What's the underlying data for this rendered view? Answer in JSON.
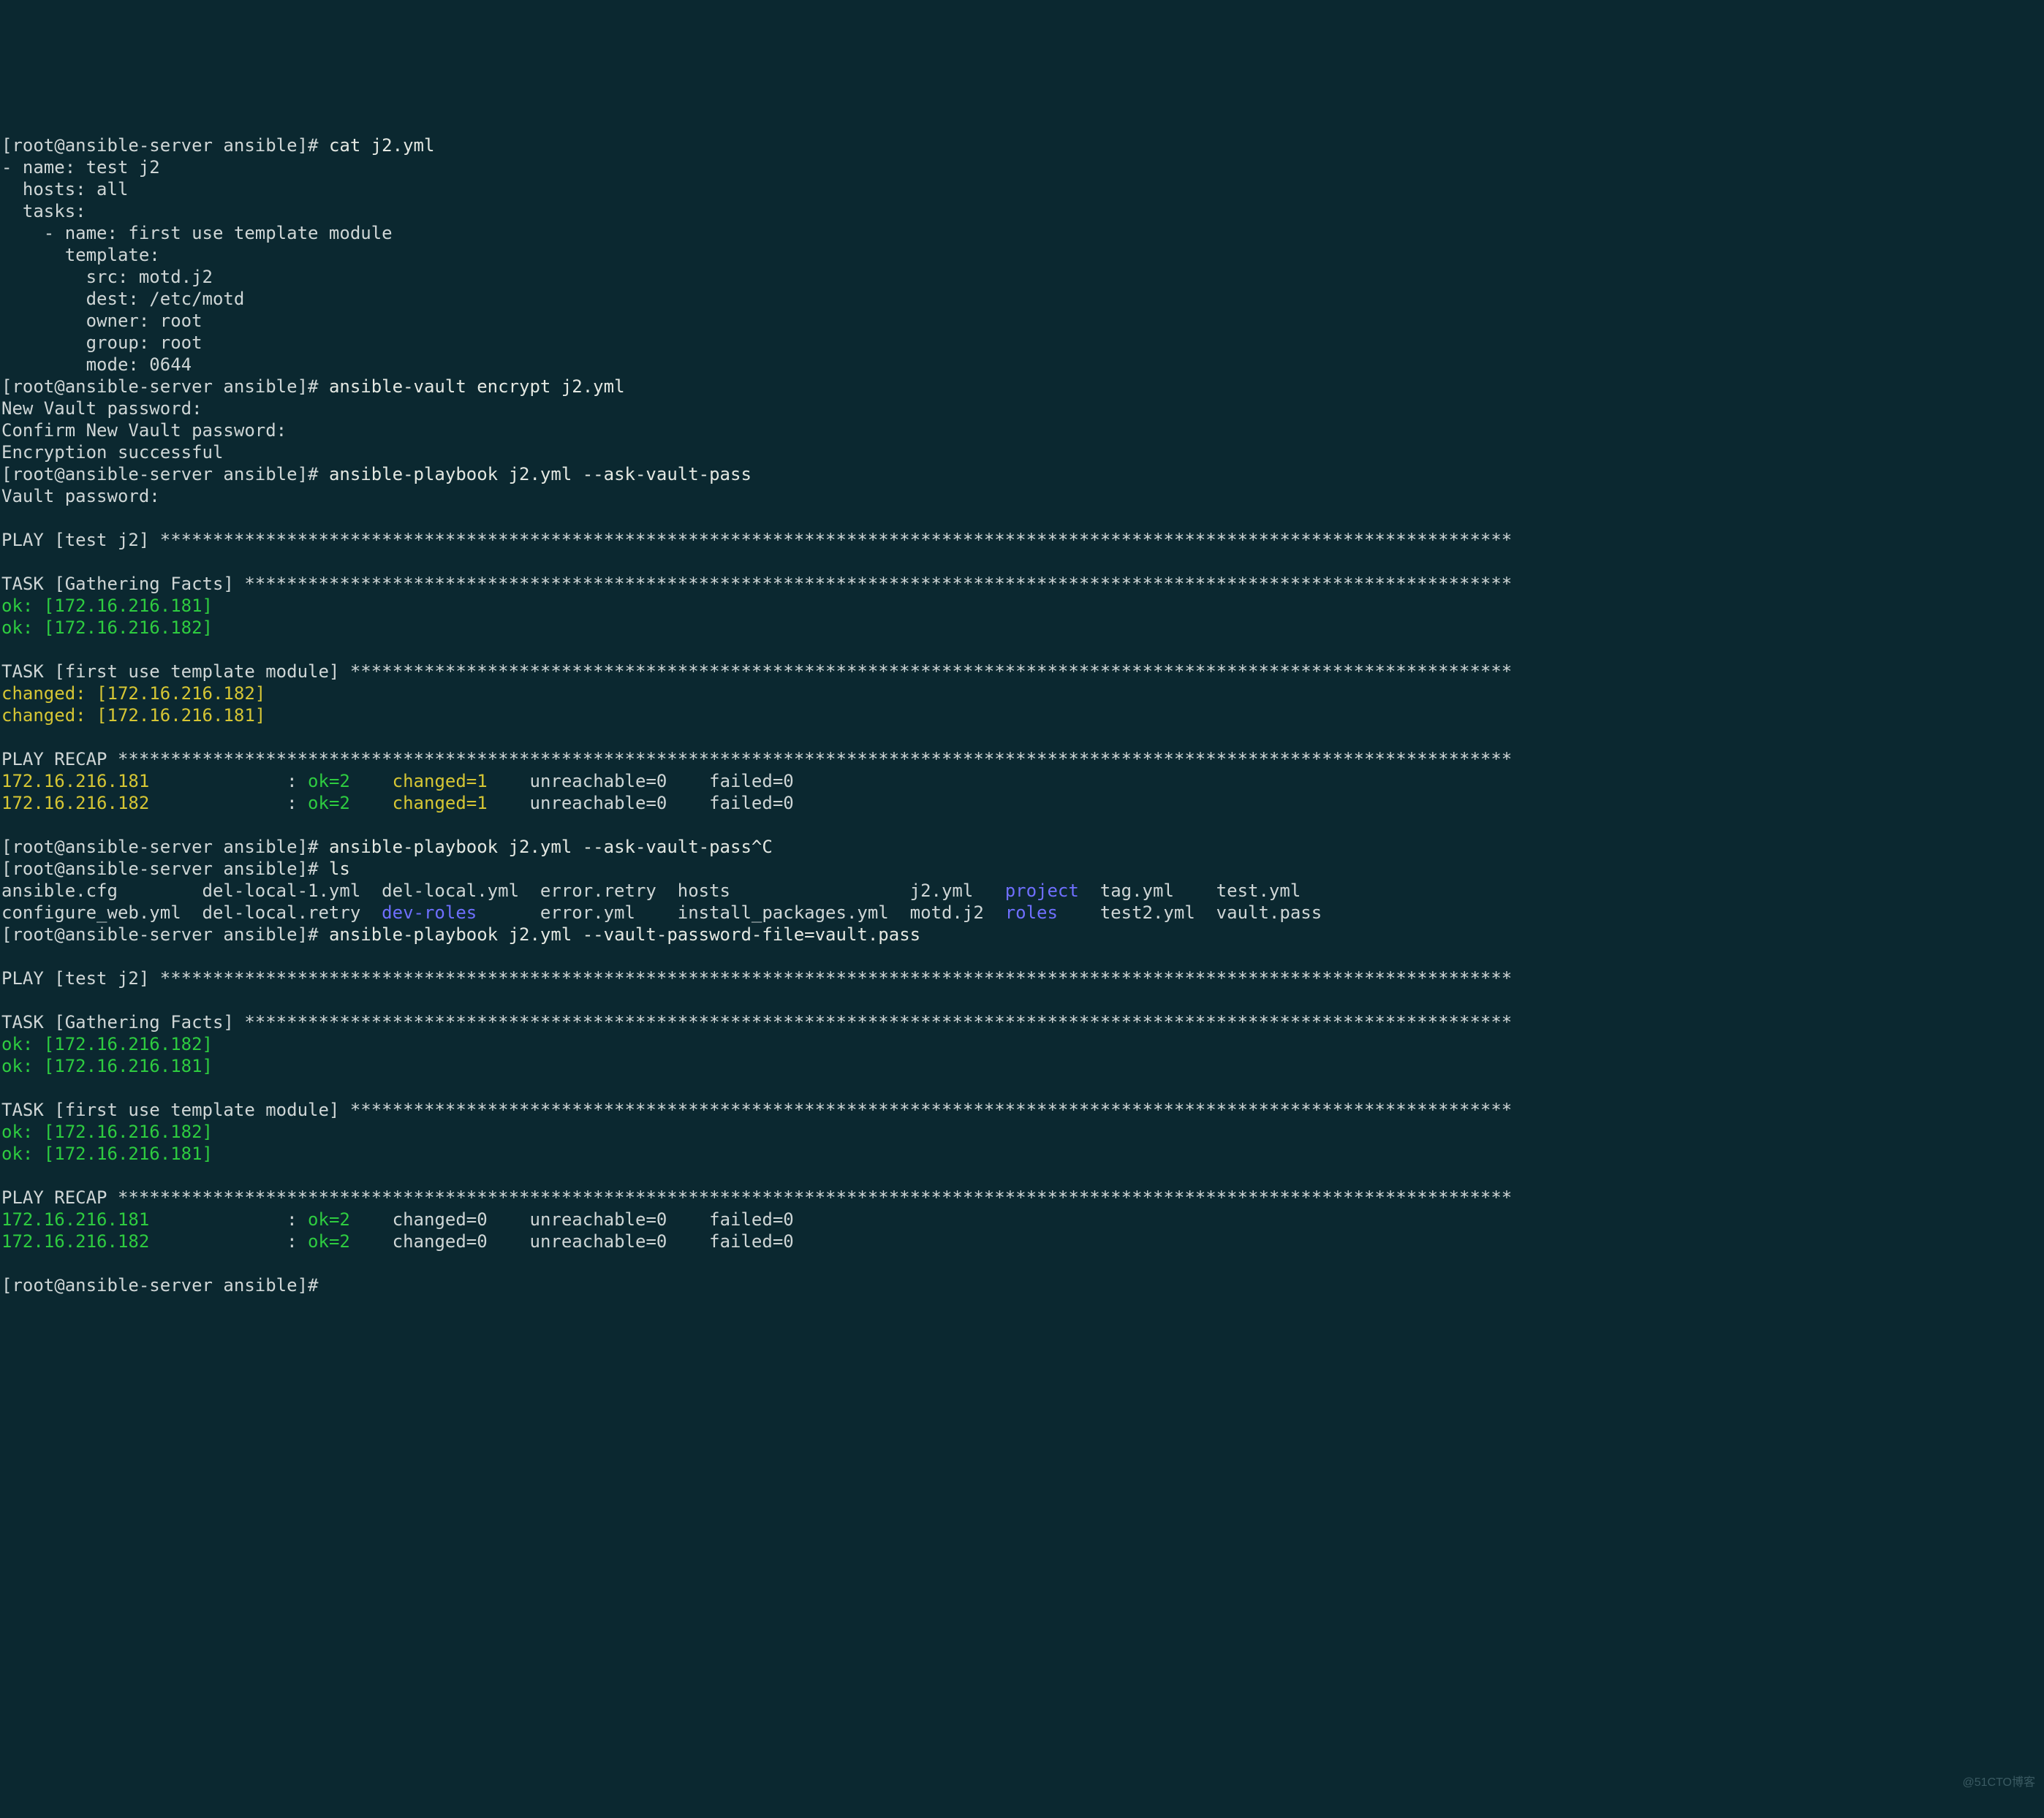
{
  "prompt": "[root@ansible-server ansible]# ",
  "cmd_cat": "cat j2.yml",
  "j2_l1": "- name: test j2",
  "j2_l2": "  hosts: all",
  "j2_l3": "  tasks:",
  "j2_l4": "    - name: first use template module",
  "j2_l5": "      template:",
  "j2_l6": "        src: motd.j2",
  "j2_l7": "        dest: /etc/motd",
  "j2_l8": "        owner: root",
  "j2_l9": "        group: root",
  "j2_l10": "        mode: 0644",
  "cmd_vault_encrypt": "ansible-vault encrypt j2.yml",
  "vault_new_pw": "New Vault password: ",
  "vault_confirm_pw": "Confirm New Vault password: ",
  "vault_success": "Encryption successful",
  "cmd_playbook_ask": "ansible-playbook j2.yml --ask-vault-pass",
  "vault_password_prompt": "Vault password: ",
  "blank": "",
  "play_header": "PLAY [test j2] ********************************************************************************************************************************",
  "task_gather": "TASK [Gathering Facts] ************************************************************************************************************************",
  "ok_181": "ok: [172.16.216.181]",
  "ok_182": "ok: [172.16.216.182]",
  "task_template": "TASK [first use template module] **************************************************************************************************************",
  "changed_182": "changed: [172.16.216.182]",
  "changed_181": "changed: [172.16.216.181]",
  "play_recap_header": "PLAY RECAP ************************************************************************************************************************************",
  "recap_host_181": "172.16.216.181",
  "recap_host_182": "172.16.216.182",
  "recap_pad": "             ",
  "recap_colon": ": ",
  "recap_ok2": "ok=2   ",
  "recap_changed1": " changed=1   ",
  "recap_changed0": " changed=0   ",
  "recap_unreach0": " unreachable=0   ",
  "recap_failed0": " failed=0   ",
  "cmd_playbook_ask_ctrlc": "ansible-playbook j2.yml --ask-vault-pass^C",
  "cmd_ls": "ls",
  "ls_l1_a": "ansible.cfg        del-local-1.yml  del-local.yml  error.retry  hosts                 j2.yml   ",
  "ls_l1_b": "project",
  "ls_l1_c": "  tag.yml    test.yml",
  "ls_l2_a": "configure_web.yml  del-local.retry  ",
  "ls_l2_b": "dev-roles",
  "ls_l2_c": "      error.yml    install_packages.yml  motd.j2  ",
  "ls_l2_d": "roles",
  "ls_l2_e": "    test2.yml  vault.pass",
  "cmd_playbook_vaultfile": "ansible-playbook j2.yml --vault-password-file=vault.pass",
  "watermark": "@51CTO博客"
}
